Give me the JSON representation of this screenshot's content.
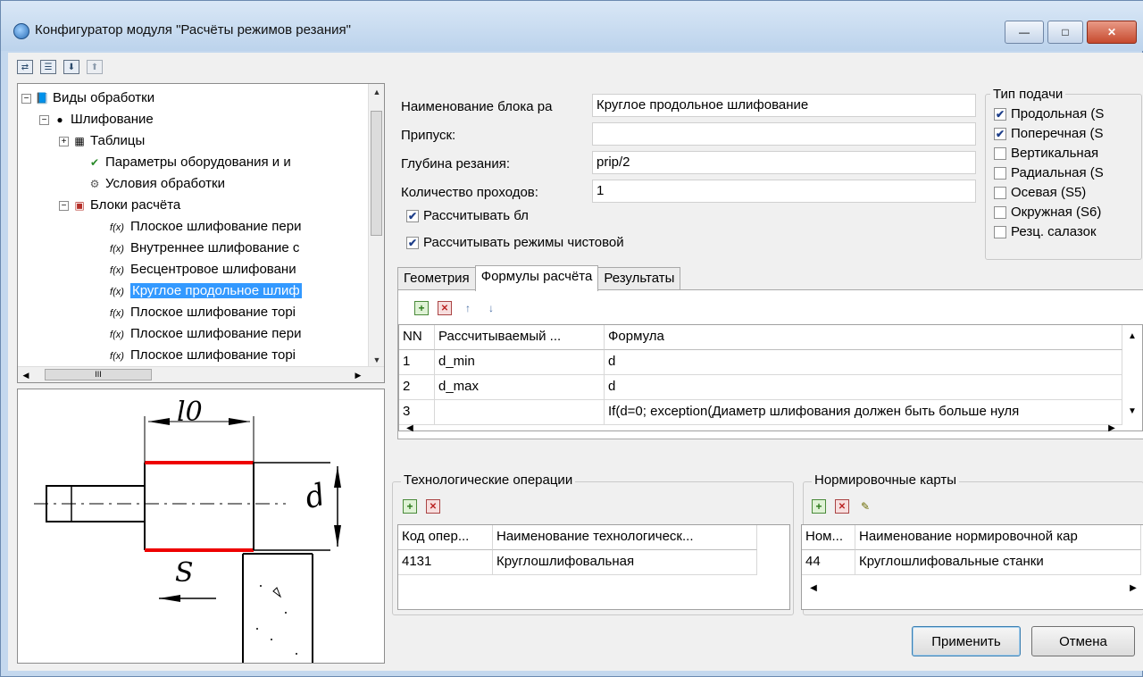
{
  "window": {
    "title": "Конфигуратор модуля \"Расчёты режимов резания\"",
    "minimize": "—",
    "maximize": "□",
    "close": "✕"
  },
  "toolbar": {
    "icons": [
      "tree-icon",
      "properties-icon",
      "import-icon",
      "export-icon"
    ]
  },
  "tree": {
    "items": [
      {
        "label": "Виды обработки",
        "icon": "book-icon",
        "expander": "−"
      },
      {
        "label": "Шлифование",
        "icon": "globe-icon",
        "expander": "−"
      },
      {
        "label": "Таблицы",
        "icon": "table-icon",
        "expander": "+"
      },
      {
        "label": "Параметры оборудования и и",
        "icon": "checklist-icon"
      },
      {
        "label": "Условия обработки",
        "icon": "settings-icon"
      },
      {
        "label": "Блоки расчёта",
        "icon": "blocks-icon",
        "expander": "−"
      },
      {
        "label": "Плоское шлифование пери",
        "icon": "fx-icon"
      },
      {
        "label": "Внутреннее шлифование с",
        "icon": "fx-icon"
      },
      {
        "label": "Бесцентровое шлифовани",
        "icon": "fx-icon"
      },
      {
        "label": "Круглое продольное шлиф",
        "icon": "fx-icon",
        "selected": true
      },
      {
        "label": "Плоское шлифование торі",
        "icon": "fx-icon"
      },
      {
        "label": "Плоское шлифование пери",
        "icon": "fx-icon"
      },
      {
        "label": "Плоское шлифование торі",
        "icon": "fx-icon"
      }
    ],
    "fx_glyph": "f(x)",
    "hscroll_thumb": "III"
  },
  "drawing": {
    "length_label": "l0",
    "diameter_label": "d",
    "feed_label": "S"
  },
  "form": {
    "name_label": "Наименование блока ра",
    "name_value": "Круглое продольное шлифование",
    "allowance_label": "Припуск:",
    "allowance_value": "",
    "depth_label": "Глубина резания:",
    "depth_value": "prip/2",
    "passes_label": "Количество проходов:",
    "passes_value": "1",
    "calc_check_label": "Рассчитывать бл",
    "finish_check_label": "Рассчитывать режимы чистовой"
  },
  "feed_type": {
    "title": "Тип подачи",
    "items": [
      {
        "label": "Продольная (S",
        "checked": true
      },
      {
        "label": "Поперечная (S",
        "checked": true
      },
      {
        "label": "Вертикальная",
        "checked": false
      },
      {
        "label": "Радиальная (S",
        "checked": false
      },
      {
        "label": "Осевая (S5)",
        "checked": false
      },
      {
        "label": "Окружная (S6)",
        "checked": false
      },
      {
        "label": "Резц. салазок",
        "checked": false
      }
    ]
  },
  "tabs": [
    {
      "label": "Геометрия",
      "active": false
    },
    {
      "label": "Формулы расчёта",
      "active": true
    },
    {
      "label": "Результаты",
      "active": false
    }
  ],
  "formulas": {
    "columns": [
      "NN",
      "Рассчитываемый ...",
      "Формула"
    ],
    "rows": [
      {
        "nn": "1",
        "param": "d_min",
        "formula": "d"
      },
      {
        "nn": "2",
        "param": "d_max",
        "formula": "d"
      },
      {
        "nn": "3",
        "param": "",
        "formula": "If(d=0; exception(Диаметр шлифования должен быть больше нуля"
      }
    ]
  },
  "tech_ops": {
    "title": "Технологические операции",
    "columns": [
      "Код опер...",
      "Наименование технологическ..."
    ],
    "rows": [
      {
        "code": "4131",
        "name": "Круглошлифовальная"
      }
    ]
  },
  "norm_cards": {
    "title": "Нормировочные карты",
    "columns": [
      "Ном...",
      "Наименование нормировочной кар"
    ],
    "rows": [
      {
        "num": "44",
        "name": "Круглошлифовальные станки"
      }
    ]
  },
  "buttons": {
    "apply": "Применить",
    "cancel": "Отмена"
  }
}
